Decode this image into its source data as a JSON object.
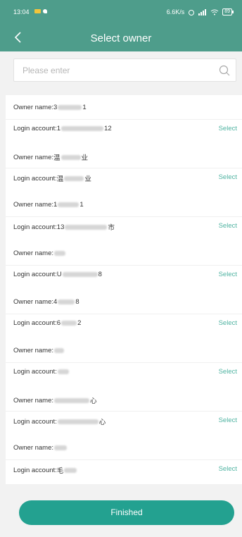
{
  "statusbar": {
    "time": "13:04",
    "network": "6.6K/s",
    "battery": "89"
  },
  "header": {
    "title": "Select owner"
  },
  "search": {
    "placeholder": "Please enter"
  },
  "labels": {
    "owner_prefix": "Owner name: ",
    "login_prefix": "Login account: ",
    "select": "Select"
  },
  "items": [
    {
      "owner_visible": "3",
      "owner_tail": "1",
      "login_visible": "1",
      "login_tail": "12"
    },
    {
      "owner_visible": "温",
      "owner_tail": "业",
      "login_visible": "温",
      "login_tail": "业"
    },
    {
      "owner_visible": "1",
      "owner_tail": "1",
      "login_visible": "13",
      "login_tail": "市"
    },
    {
      "owner_visible": "",
      "owner_tail": "",
      "login_visible": "U",
      "login_tail": "8"
    },
    {
      "owner_visible": "4",
      "owner_tail": "8",
      "login_visible": "6",
      "login_tail": "2"
    },
    {
      "owner_visible": "",
      "owner_tail": "",
      "login_visible": "",
      "login_tail": ""
    },
    {
      "owner_visible": "",
      "owner_tail": "心",
      "login_visible": "",
      "login_tail": "心"
    },
    {
      "owner_visible": "",
      "owner_tail": "",
      "login_visible": "毛",
      "login_tail": ""
    }
  ],
  "footer": {
    "button": "Finished"
  },
  "colors": {
    "header": "#4e9d8b",
    "accent": "#4fb3a1",
    "button": "#23a190"
  }
}
